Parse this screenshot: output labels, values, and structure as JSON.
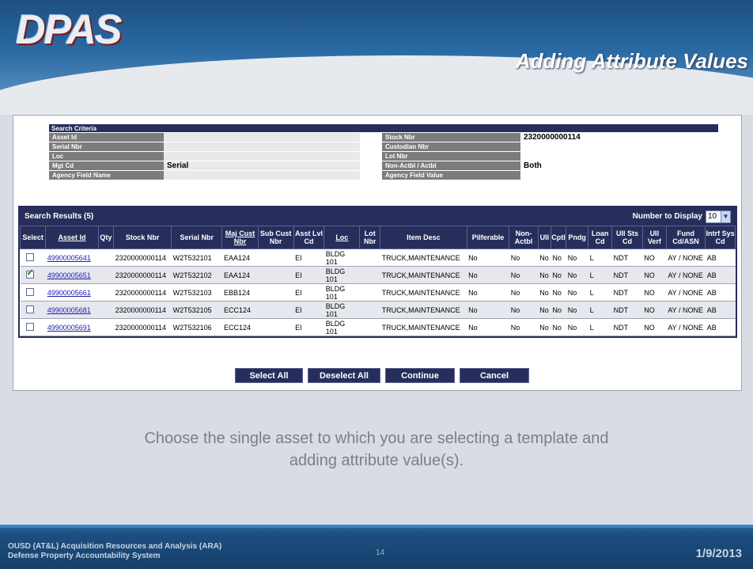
{
  "header": {
    "logo_text": "DPAS",
    "slide_title": "Adding Attribute Values"
  },
  "criteria": {
    "title": "Search Criteria",
    "rows": [
      {
        "left_label": "Asset Id",
        "left_value": "",
        "right_label": "Stock Nbr",
        "right_value": "2320000000114"
      },
      {
        "left_label": "Serial Nbr",
        "left_value": "",
        "right_label": "Custodian Nbr",
        "right_value": ""
      },
      {
        "left_label": "Loc",
        "left_value": "",
        "right_label": "Lot Nbr",
        "right_value": ""
      },
      {
        "left_label": "Mgt Cd",
        "left_value": "Serial",
        "right_label": "Non-Actbl / Actbl",
        "right_value": "Both"
      },
      {
        "left_label": "Agency Field Name",
        "left_value": "",
        "right_label": "Agency Field Value",
        "right_value": ""
      }
    ]
  },
  "results": {
    "title": "Search Results (5)",
    "number_to_display_label": "Number to Display",
    "number_to_display_value": "10",
    "columns": [
      "Select",
      "Asset Id",
      "Qty",
      "Stock Nbr",
      "Serial Nbr",
      "Maj Cust Nbr",
      "Sub Cust Nbr",
      "Asst Lvl Cd",
      "Loc",
      "Lot Nbr",
      "Item Desc",
      "Pilferable",
      "Non-Actbl",
      "UII",
      "Cptl",
      "Pndg",
      "Loan Cd",
      "UII Sts Cd",
      "UII Verf",
      "Fund Cd/ASN",
      "Intrf Sys Cd"
    ],
    "rows": [
      {
        "checked": false,
        "asset_id": "49900005641",
        "qty": "",
        "stock": "2320000000114",
        "serial": "W2T532101",
        "maj": "EAA124",
        "sub": "",
        "asst": "EI",
        "loc": "BLDG 101",
        "lot": "",
        "desc": "TRUCK,MAINTENANCE",
        "pilf": "No",
        "nonact": "No",
        "uii": "No",
        "cptl": "No",
        "pndg": "No",
        "loan": "L",
        "uiists": "NDT",
        "uiiverf": "NO",
        "fund": "AY / NONE",
        "intrf": "AB"
      },
      {
        "checked": true,
        "asset_id": "49900005651",
        "qty": "",
        "stock": "2320000000114",
        "serial": "W2T532102",
        "maj": "EAA124",
        "sub": "",
        "asst": "EI",
        "loc": "BLDG 101",
        "lot": "",
        "desc": "TRUCK,MAINTENANCE",
        "pilf": "No",
        "nonact": "No",
        "uii": "No",
        "cptl": "No",
        "pndg": "No",
        "loan": "L",
        "uiists": "NDT",
        "uiiverf": "NO",
        "fund": "AY / NONE",
        "intrf": "AB"
      },
      {
        "checked": false,
        "asset_id": "49900005661",
        "qty": "",
        "stock": "2320000000114",
        "serial": "W2T532103",
        "maj": "EBB124",
        "sub": "",
        "asst": "EI",
        "loc": "BLDG 101",
        "lot": "",
        "desc": "TRUCK,MAINTENANCE",
        "pilf": "No",
        "nonact": "No",
        "uii": "No",
        "cptl": "No",
        "pndg": "No",
        "loan": "L",
        "uiists": "NDT",
        "uiiverf": "NO",
        "fund": "AY / NONE",
        "intrf": "AB"
      },
      {
        "checked": false,
        "asset_id": "49900005681",
        "qty": "",
        "stock": "2320000000114",
        "serial": "W2T532105",
        "maj": "ECC124",
        "sub": "",
        "asst": "EI",
        "loc": "BLDG 101",
        "lot": "",
        "desc": "TRUCK,MAINTENANCE",
        "pilf": "No",
        "nonact": "No",
        "uii": "No",
        "cptl": "No",
        "pndg": "No",
        "loan": "L",
        "uiists": "NDT",
        "uiiverf": "NO",
        "fund": "AY / NONE",
        "intrf": "AB"
      },
      {
        "checked": false,
        "asset_id": "49900005691",
        "qty": "",
        "stock": "2320000000114",
        "serial": "W2T532106",
        "maj": "ECC124",
        "sub": "",
        "asst": "EI",
        "loc": "BLDG 101",
        "lot": "",
        "desc": "TRUCK,MAINTENANCE",
        "pilf": "No",
        "nonact": "No",
        "uii": "No",
        "cptl": "No",
        "pndg": "No",
        "loan": "L",
        "uiists": "NDT",
        "uiiverf": "NO",
        "fund": "AY / NONE",
        "intrf": "AB"
      }
    ]
  },
  "buttons": {
    "select_all": "Select All",
    "deselect_all": "Deselect All",
    "continue": "Continue",
    "cancel": "Cancel"
  },
  "caption": "Choose the single asset to which you are selecting a template and adding attribute value(s).",
  "footer": {
    "line1": "OUSD (AT&L) Acquisition Resources and Analysis (ARA)",
    "line2": "Defense Property Accountability System",
    "page": "14",
    "date": "1/9/2013"
  },
  "colors": {
    "header_navy": "#282e5c",
    "link_blue": "#1a1ab5",
    "footer_blue": "#1b4f82"
  }
}
